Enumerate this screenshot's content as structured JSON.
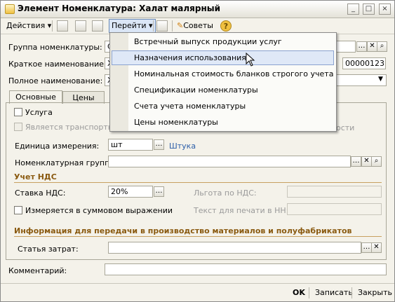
{
  "window": {
    "title": "Элемент Номенклатура: Халат малярный"
  },
  "titlebar_buttons": [
    "_",
    "□",
    "×"
  ],
  "toolbar": {
    "actions_label": "Действия",
    "goto_label": "Перейти",
    "tips_label": "Советы",
    "help_label": "?"
  },
  "fields": {
    "group_label": "Группа номенклатуры:",
    "group_value": "С",
    "short_name_label": "Краткое наименование:",
    "short_name_value": "Х",
    "code_value": "00000123",
    "full_name_label": "Полное наименование:",
    "full_name_value": "Х"
  },
  "tabs": [
    "Основные",
    "Цены"
  ],
  "main": {
    "service_label": "Услуга",
    "transport_label": "Является транспортной",
    "transport_suffix": "ости",
    "unit_label": "Единица измерения:",
    "unit_value": "шт",
    "unit_link": "Штука",
    "nom_group_label": "Номенклатурная группа:",
    "vat_section": "Учет НДС",
    "vat_rate_label": "Ставка НДС:",
    "vat_rate_value": "20%",
    "vat_benefit_label": "Льгота по НДС:",
    "sum_measure_label": "Измеряется в суммовом выражении",
    "print_text_label": "Текст для печати в НН:",
    "production_section": "Информация для передачи в производство материалов и полуфабрикатов",
    "cost_item_label": "Статья затрат:"
  },
  "comment_label": "Комментарий:",
  "footer": {
    "ok": "OK",
    "save": "Записать",
    "close": "Закрыть"
  },
  "menu": {
    "items": [
      "Встречный выпуск продукции услуг",
      "Назначения использования",
      "Номинальная стоимость бланков строгого учета",
      "Спецификации номенклатуры",
      "Счета учета номенклатуры",
      "Цены номенклатуры"
    ],
    "highlighted": 1
  },
  "colors": {
    "section": "#8a5a10",
    "link": "#2c5ea8",
    "highlight": "#dfe8f7"
  }
}
